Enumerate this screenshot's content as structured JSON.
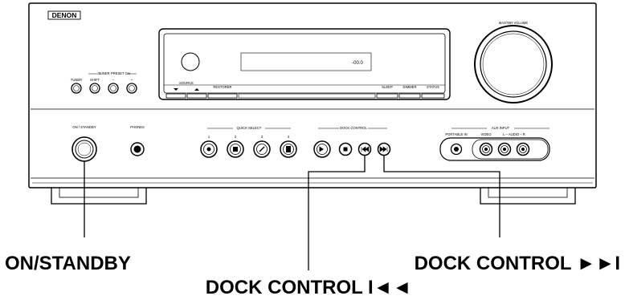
{
  "brand": "DENON",
  "panel_labels": {
    "master_volume": "MASTER VOLUME",
    "tuner_preset": "TUNER PRESET CH",
    "tuner": "TUNER",
    "shift": "SHIFT",
    "minus": "–",
    "plus": "+",
    "source": "SOURCE",
    "restorer": "RESTORER",
    "sleep": "SLEEP",
    "dimmer": "DIMMER",
    "status": "STATUS",
    "on_standby": "ON / STANDBY",
    "phones": "PHONES",
    "quick_select": "QUICK SELECT",
    "qs1": "1",
    "qs2": "2",
    "qs3": "3",
    "qs4": "4",
    "dock_control": "DOCK CONTROL",
    "aux_input": "AUX INPUT",
    "portable_in": "PORTABLE IN",
    "video": "VIDEO",
    "audio_l_r": "L – AUDIO – R",
    "display_readout": "-00.0"
  },
  "callouts": {
    "on_standby": "ON/STANDBY",
    "dock_next": "DOCK CONTROL ►►I",
    "dock_prev": "DOCK CONTROL I◄◄"
  }
}
